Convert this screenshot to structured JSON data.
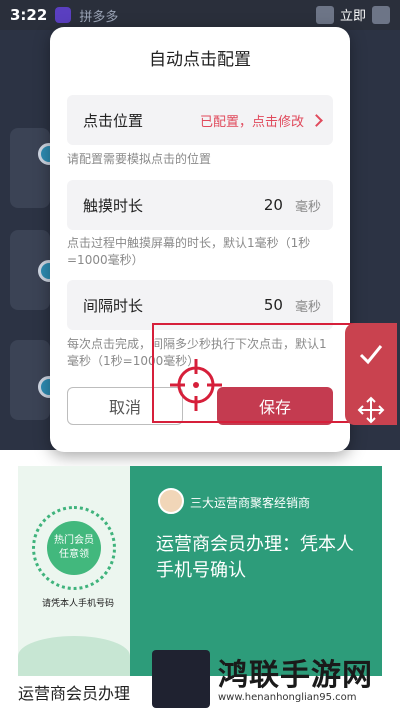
{
  "statusbar": {
    "time": "3:22",
    "app_title": "拼多多",
    "right_text": "立即"
  },
  "dialog": {
    "title": "自动点击配置",
    "rows": [
      {
        "label": "点击位置",
        "value": "已配置，点击修改"
      },
      {
        "label": "触摸时长",
        "value": "20",
        "unit": "毫秒"
      },
      {
        "label": "间隔时长",
        "value": "50",
        "unit": "毫秒"
      }
    ],
    "hints": [
      "请配置需要模拟点击的位置",
      "点击过程中触摸屏幕的时长，默认1毫秒（1秒=1000毫秒）",
      "每次点击完成，间隔多少秒执行下次点击，默认1毫秒（1秒=1000毫秒）"
    ],
    "cancel_label": "取消",
    "save_label": "保存"
  },
  "overlay": {
    "confirm_icon": "check-icon",
    "move_icon": "move-icon",
    "accent": "#c9424f"
  },
  "ad": {
    "left_badge_line1": "热门会员",
    "left_badge_line2": "任意领",
    "left_caption": "请凭本人手机号码",
    "brand": "三大运营商聚客经销商",
    "headline": "运营商会员办理：凭本人手机号确认",
    "caption": "运营商会员办理"
  },
  "watermark": {
    "text": "鸿联手游网",
    "url": "www.henanhonglian95.com"
  }
}
